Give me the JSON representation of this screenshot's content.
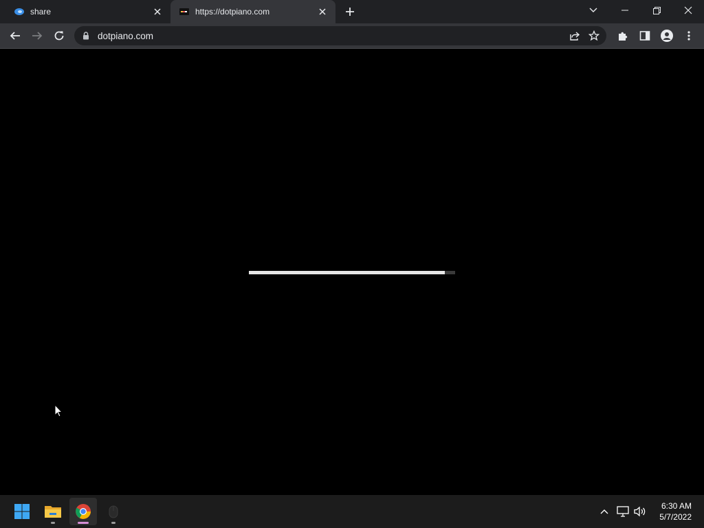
{
  "browser": {
    "tabs": [
      {
        "title": "share",
        "favicon": "edge-share-icon",
        "active": false
      },
      {
        "title": "https://dotpiano.com",
        "favicon": "dotpiano-icon",
        "active": true
      }
    ],
    "new_tab_icon": "plus-icon",
    "window_controls": [
      "tab-search-chevron",
      "minimize",
      "restore",
      "close"
    ]
  },
  "toolbar": {
    "back_icon": "back-arrow-icon",
    "forward_icon": "forward-arrow-icon",
    "reload_icon": "reload-icon",
    "url": "dotpiano.com",
    "lock_icon": "lock-icon",
    "share_icon": "share-icon",
    "bookmark_icon": "star-icon",
    "extensions_icon": "puzzle-icon",
    "side_panel_icon": "side-panel-icon",
    "profile_icon": "profile-icon",
    "menu_icon": "kebab-menu-icon"
  },
  "page": {
    "loading_progress": 0.95,
    "background": "#000000",
    "progress_color": "#e6e6e6"
  },
  "taskbar": {
    "apps": [
      "windows-start-icon",
      "file-explorer-icon",
      "chrome-icon",
      "mouse-app-icon"
    ],
    "tray": [
      "chevron-up-icon",
      "network-icon",
      "volume-icon"
    ],
    "time": "6:30 AM",
    "date": "5/7/2022"
  }
}
